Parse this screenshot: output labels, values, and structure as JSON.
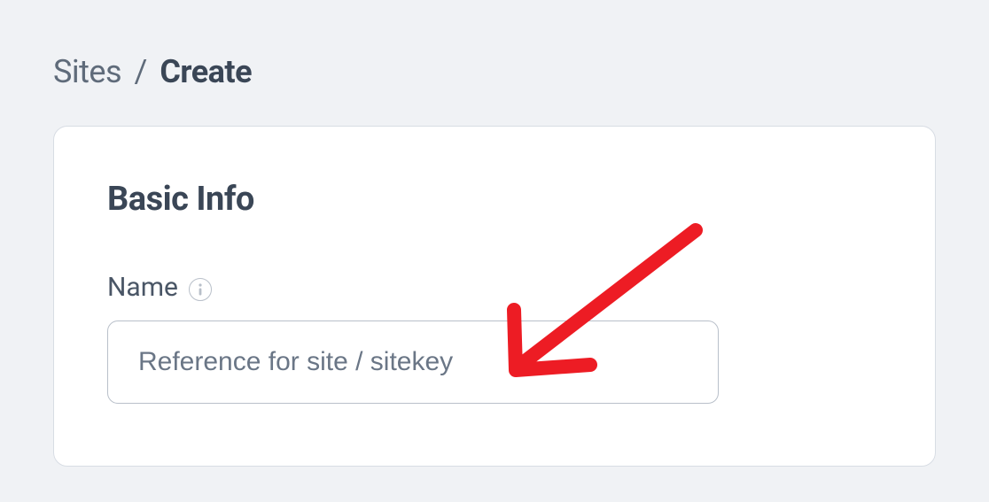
{
  "breadcrumb": {
    "parent": "Sites",
    "separator": "/",
    "current": "Create"
  },
  "card": {
    "title": "Basic Info"
  },
  "fields": {
    "name": {
      "label": "Name",
      "placeholder": "Reference for site / sitekey",
      "value": ""
    }
  },
  "annotation": {
    "arrow_color": "#ed1c24"
  }
}
